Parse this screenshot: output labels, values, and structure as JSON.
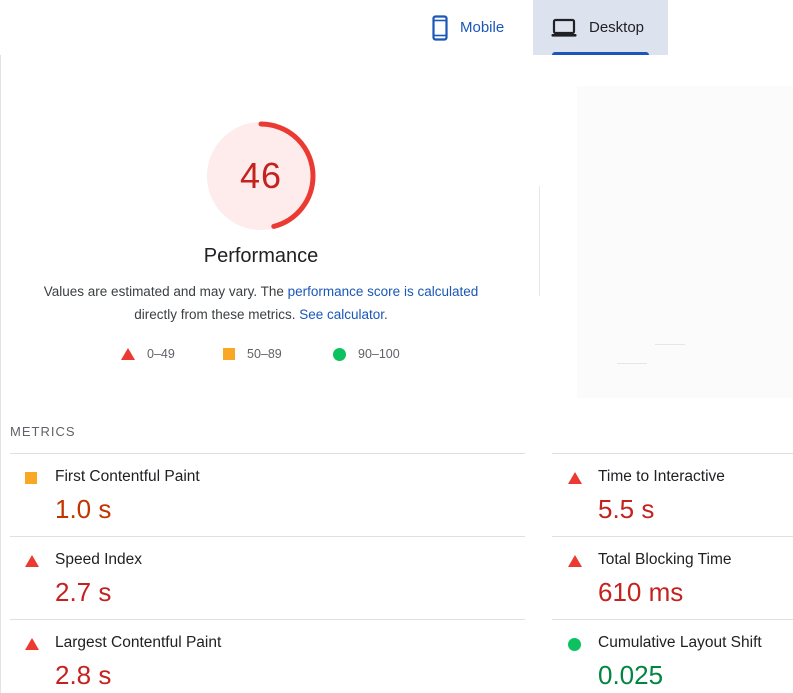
{
  "tabs": {
    "mobile": {
      "label": "Mobile",
      "icon": "phone-icon"
    },
    "desktop": {
      "label": "Desktop",
      "icon": "laptop-icon",
      "selected": true
    }
  },
  "score": {
    "value": "46",
    "fraction": 0.46,
    "title": "Performance",
    "description_prefix": "Values are estimated and may vary. The ",
    "link_score": "performance score is calculated",
    "description_mid": " directly from these metrics. ",
    "link_calculator": "See calculator",
    "description_suffix": "."
  },
  "legend": {
    "fail": "0–49",
    "average": "50–89",
    "pass": "90–100"
  },
  "metrics_title": "METRICS",
  "metrics": [
    {
      "label": "First Contentful Paint",
      "value": "1.0 s",
      "status": "average"
    },
    {
      "label": "Time to Interactive",
      "value": "5.5 s",
      "status": "fail"
    },
    {
      "label": "Speed Index",
      "value": "2.7 s",
      "status": "fail"
    },
    {
      "label": "Total Blocking Time",
      "value": "610 ms",
      "status": "fail"
    },
    {
      "label": "Largest Contentful Paint",
      "value": "2.8 s",
      "status": "fail"
    },
    {
      "label": "Cumulative Layout Shift",
      "value": "0.025",
      "status": "pass"
    }
  ],
  "colors": {
    "fail": "#eb3a32",
    "average": "#f9a825",
    "pass": "#0cc15f",
    "fail_text": "#c5221f",
    "average_text": "#c33300",
    "pass_text": "#018642",
    "gauge_bg": "#fdeceb",
    "accent": "#1a57b8"
  }
}
